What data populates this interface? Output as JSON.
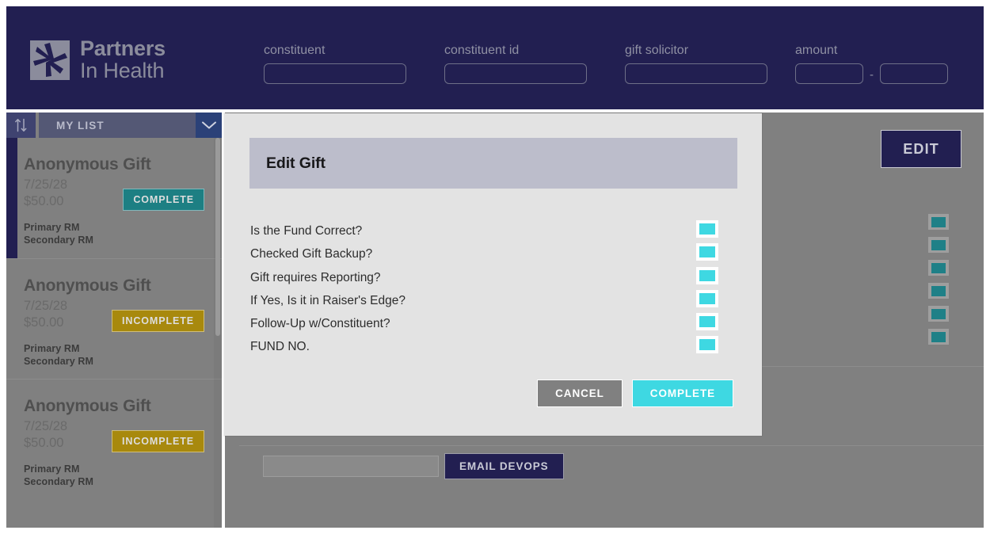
{
  "app": {
    "brand_line1": "Partners",
    "brand_line2": "In Health",
    "logo_icon": "partners-in-health-hands-logo"
  },
  "colors": {
    "navy": "#221f51",
    "panel_gray": "#808080",
    "modal_bg": "#e3e3e3",
    "modal_header": "#bcbdcb",
    "teal_bright": "#3ed8e2",
    "teal_dark": "#1d7f83",
    "gold": "#a8890d"
  },
  "header": {
    "fields": [
      {
        "label": "constituent",
        "value": "",
        "placeholder": ""
      },
      {
        "label": "constituent id",
        "value": "",
        "placeholder": ""
      },
      {
        "label": "gift solicitor",
        "value": "",
        "placeholder": ""
      }
    ],
    "amount": {
      "label": "amount",
      "min_value": "",
      "max_value": "",
      "separator": "-"
    }
  },
  "sidebar": {
    "sort_icon": "sort-arrows-icon",
    "list_name": "MY LIST",
    "chevron_icon": "chevron-down-icon",
    "cards": [
      {
        "title": "Anonymous Gift",
        "date": "7/25/28",
        "amount": "$50.00",
        "status": "COMPLETE",
        "status_kind": "complete",
        "primary_rm": "Primary RM",
        "secondary_rm": "Secondary RM",
        "selected": true
      },
      {
        "title": "Anonymous Gift",
        "date": "7/25/28",
        "amount": "$50.00",
        "status": "INCOMPLETE",
        "status_kind": "incomplete",
        "primary_rm": "Primary RM",
        "secondary_rm": "Secondary RM",
        "selected": false
      },
      {
        "title": "Anonymous Gift",
        "date": "7/25/28",
        "amount": "$50.00",
        "status": "INCOMPLETE",
        "status_kind": "incomplete",
        "primary_rm": "Primary RM",
        "secondary_rm": "Secondary RM",
        "selected": false
      }
    ]
  },
  "detail": {
    "edit_label": "EDIT",
    "toggle_count": 6,
    "devops": {
      "input_value": "",
      "input_placeholder": "",
      "button_label": "EMAIL DEVOPS"
    }
  },
  "modal": {
    "title": "Edit Gift",
    "items": [
      {
        "label": "Is the Fund Correct?",
        "checked": true
      },
      {
        "label": "Checked Gift Backup?",
        "checked": true
      },
      {
        "label": "Gift requires Reporting?",
        "checked": true
      },
      {
        "label": "If Yes, Is it in Raiser's Edge?",
        "checked": true
      },
      {
        "label": "Follow-Up w/Constituent?",
        "checked": true
      },
      {
        "label": "FUND NO.",
        "checked": true
      }
    ],
    "cancel_label": "CANCEL",
    "complete_label": "COMPLETE"
  }
}
